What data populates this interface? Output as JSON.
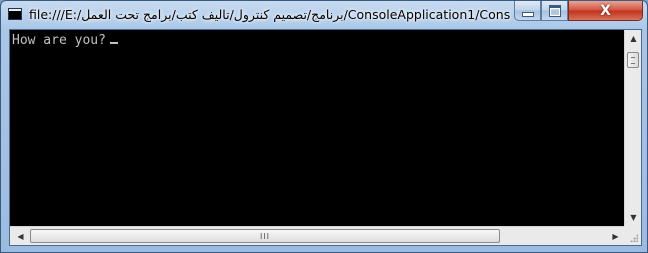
{
  "window": {
    "title": "file:///E:/برنامج/تصميم كنترول/تاليف كتب/برامج تحت العمل/ConsoleApplication1/Cons...",
    "close_glyph": "X"
  },
  "console": {
    "output_text": "How are you?"
  },
  "scrollbars": {
    "up_arrow": "▲",
    "down_arrow": "▼",
    "left_arrow": "◀",
    "right_arrow": "▶",
    "thumb_grip": "III"
  },
  "icons": {
    "system_menu": "console-icon",
    "minimize": "minimize-icon",
    "maximize": "maximize-icon",
    "close": "close-icon"
  },
  "colors": {
    "console_background": "#000000",
    "console_text": "#c0c0c0",
    "close_button": "#c1311c",
    "frame": "#a9c6e7"
  }
}
